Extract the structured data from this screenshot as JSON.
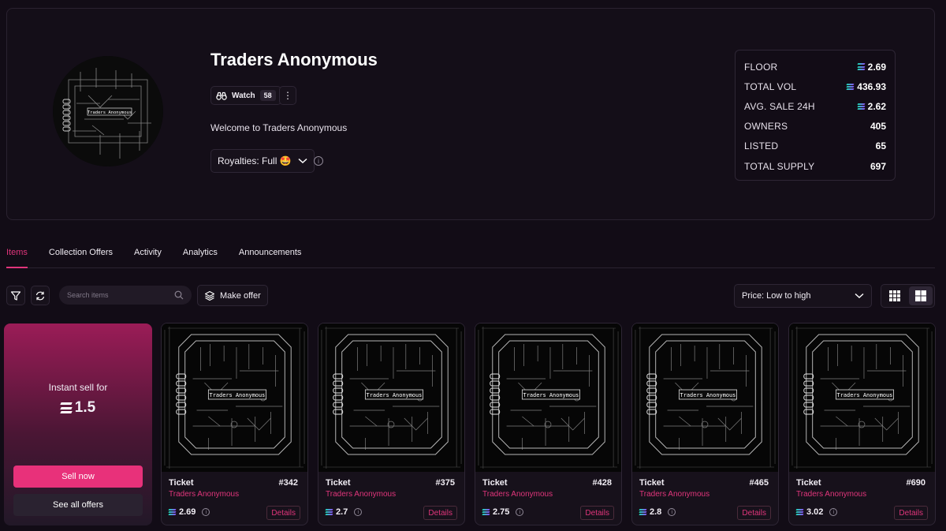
{
  "collection": {
    "title": "Traders Anonymous",
    "art_label": "Traders Anonymous",
    "watch_label": "Watch",
    "watch_count": "58",
    "more_icon": "more-vertical-icon",
    "description": "Welcome to Traders Anonymous",
    "royalties_label": "Royalties: Full 🤩"
  },
  "stats": [
    {
      "label": "FLOOR",
      "value": "2.69",
      "sol": true
    },
    {
      "label": "TOTAL VOL",
      "value": "436.93",
      "sol": true
    },
    {
      "label": "AVG. SALE 24H",
      "value": "2.62",
      "sol": true
    },
    {
      "label": "OWNERS",
      "value": "405",
      "sol": false
    },
    {
      "label": "LISTED",
      "value": "65",
      "sol": false
    },
    {
      "label": "TOTAL SUPPLY",
      "value": "697",
      "sol": false
    }
  ],
  "tabs": [
    "Items",
    "Collection Offers",
    "Activity",
    "Analytics",
    "Announcements"
  ],
  "toolbar": {
    "search_placeholder": "Search items",
    "make_offer_label": "Make offer",
    "sort_label": "Price: Low to high"
  },
  "instant_sell": {
    "label": "Instant sell for",
    "amount": "1.5",
    "sell_now_label": "Sell now",
    "see_offers_label": "See all offers"
  },
  "items": [
    {
      "name": "Ticket",
      "number": "#342",
      "collection": "Traders Anonymous",
      "price": "2.69",
      "details_label": "Details"
    },
    {
      "name": "Ticket",
      "number": "#375",
      "collection": "Traders Anonymous",
      "price": "2.7",
      "details_label": "Details"
    },
    {
      "name": "Ticket",
      "number": "#428",
      "collection": "Traders Anonymous",
      "price": "2.75",
      "details_label": "Details"
    },
    {
      "name": "Ticket",
      "number": "#465",
      "collection": "Traders Anonymous",
      "price": "2.8",
      "details_label": "Details"
    },
    {
      "name": "Ticket",
      "number": "#690",
      "collection": "Traders Anonymous",
      "price": "3.02",
      "details_label": "Details"
    }
  ],
  "colors": {
    "accent": "#e0357b",
    "background": "#120c16",
    "sell_button": "#e8317a"
  }
}
